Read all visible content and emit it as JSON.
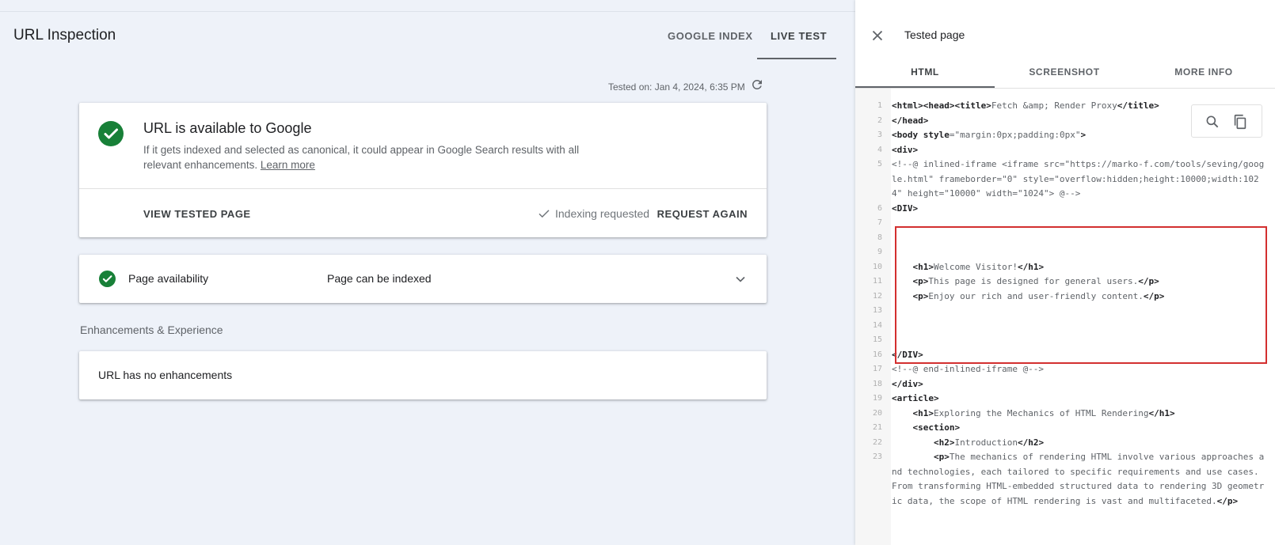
{
  "header": {
    "title": "URL Inspection",
    "tabs": [
      "GOOGLE INDEX",
      "LIVE TEST"
    ],
    "tested_on": "Tested on: Jan 4, 2024, 6:35 PM"
  },
  "status_card": {
    "title": "URL is available to Google",
    "description": "If it gets indexed and selected as canonical, it could appear in Google Search results with all relevant enhancements.",
    "learn_more": "Learn more",
    "view_button": "VIEW TESTED PAGE",
    "indexing_status": "Indexing requested",
    "request_button": "REQUEST AGAIN"
  },
  "availability": {
    "label": "Page availability",
    "value": "Page can be indexed"
  },
  "enhancements": {
    "section_title": "Enhancements & Experience",
    "message": "URL has no enhancements"
  },
  "panel": {
    "title": "Tested page",
    "tabs": [
      "HTML",
      "SCREENSHOT",
      "MORE INFO"
    ]
  },
  "code": {
    "lines": [
      {
        "n": "1",
        "parts": [
          [
            "t",
            "<html><head><title>"
          ],
          [
            "s",
            "Fetch &amp; Render Proxy"
          ],
          [
            "t",
            "</title>"
          ]
        ]
      },
      {
        "n": "2",
        "parts": [
          [
            "t",
            "</head>"
          ]
        ]
      },
      {
        "n": "3",
        "parts": [
          [
            "t",
            "<body "
          ],
          [
            "t",
            "style"
          ],
          [
            "s",
            "=\"margin:0px;padding:0px\""
          ],
          [
            "t",
            ">"
          ]
        ]
      },
      {
        "n": "4",
        "parts": [
          [
            "t",
            "<div>"
          ]
        ]
      },
      {
        "n": "5",
        "parts": [
          [
            "s",
            "<!--@ inlined-iframe <iframe src=\"https://marko-f.com/tools/seving/google.html\" frameborder=\"0\" style=\"overflow:hidden;height:10000;width:1024\" height=\"10000\" width=\"1024\"> @-->"
          ]
        ]
      },
      {
        "n": "6",
        "parts": [
          [
            "t",
            "<DIV>"
          ]
        ]
      },
      {
        "n": "7",
        "parts": []
      },
      {
        "n": "8",
        "parts": []
      },
      {
        "n": "9",
        "parts": []
      },
      {
        "n": "10",
        "parts": [
          [
            "s",
            "    "
          ],
          [
            "t",
            "<h1>"
          ],
          [
            "s",
            "Welcome Visitor!"
          ],
          [
            "t",
            "</h1>"
          ]
        ]
      },
      {
        "n": "11",
        "parts": [
          [
            "s",
            "    "
          ],
          [
            "t",
            "<p>"
          ],
          [
            "s",
            "This page is designed for general users."
          ],
          [
            "t",
            "</p>"
          ]
        ]
      },
      {
        "n": "12",
        "parts": [
          [
            "s",
            "    "
          ],
          [
            "t",
            "<p>"
          ],
          [
            "s",
            "Enjoy our rich and user-friendly content."
          ],
          [
            "t",
            "</p>"
          ]
        ]
      },
      {
        "n": "13",
        "parts": []
      },
      {
        "n": "14",
        "parts": []
      },
      {
        "n": "15",
        "parts": []
      },
      {
        "n": "16",
        "parts": [
          [
            "t",
            "</DIV>"
          ]
        ]
      },
      {
        "n": "17",
        "parts": [
          [
            "s",
            "<!--@ end-inlined-iframe @-->"
          ]
        ]
      },
      {
        "n": "18",
        "parts": [
          [
            "t",
            "</div>"
          ]
        ]
      },
      {
        "n": "19",
        "parts": [
          [
            "t",
            "<article>"
          ]
        ]
      },
      {
        "n": "20",
        "parts": [
          [
            "s",
            "    "
          ],
          [
            "t",
            "<h1>"
          ],
          [
            "s",
            "Exploring the Mechanics of HTML Rendering"
          ],
          [
            "t",
            "</h1>"
          ]
        ]
      },
      {
        "n": "21",
        "parts": [
          [
            "s",
            "    "
          ],
          [
            "t",
            "<section>"
          ]
        ]
      },
      {
        "n": "22",
        "parts": [
          [
            "s",
            "        "
          ],
          [
            "t",
            "<h2>"
          ],
          [
            "s",
            "Introduction"
          ],
          [
            "t",
            "</h2>"
          ]
        ]
      },
      {
        "n": "23",
        "parts": [
          [
            "s",
            "        "
          ],
          [
            "t",
            "<p>"
          ],
          [
            "s",
            "The mechanics of rendering HTML involve various approaches and technologies, each tailored to specific requirements and use cases. From transforming HTML-embedded structured data to rendering 3D geometric data, the scope of HTML rendering is vast and multifaceted."
          ],
          [
            "t",
            "</p>"
          ]
        ]
      }
    ]
  },
  "colors": {
    "success_green": "#188038",
    "highlight_red": "#d32f2f"
  }
}
